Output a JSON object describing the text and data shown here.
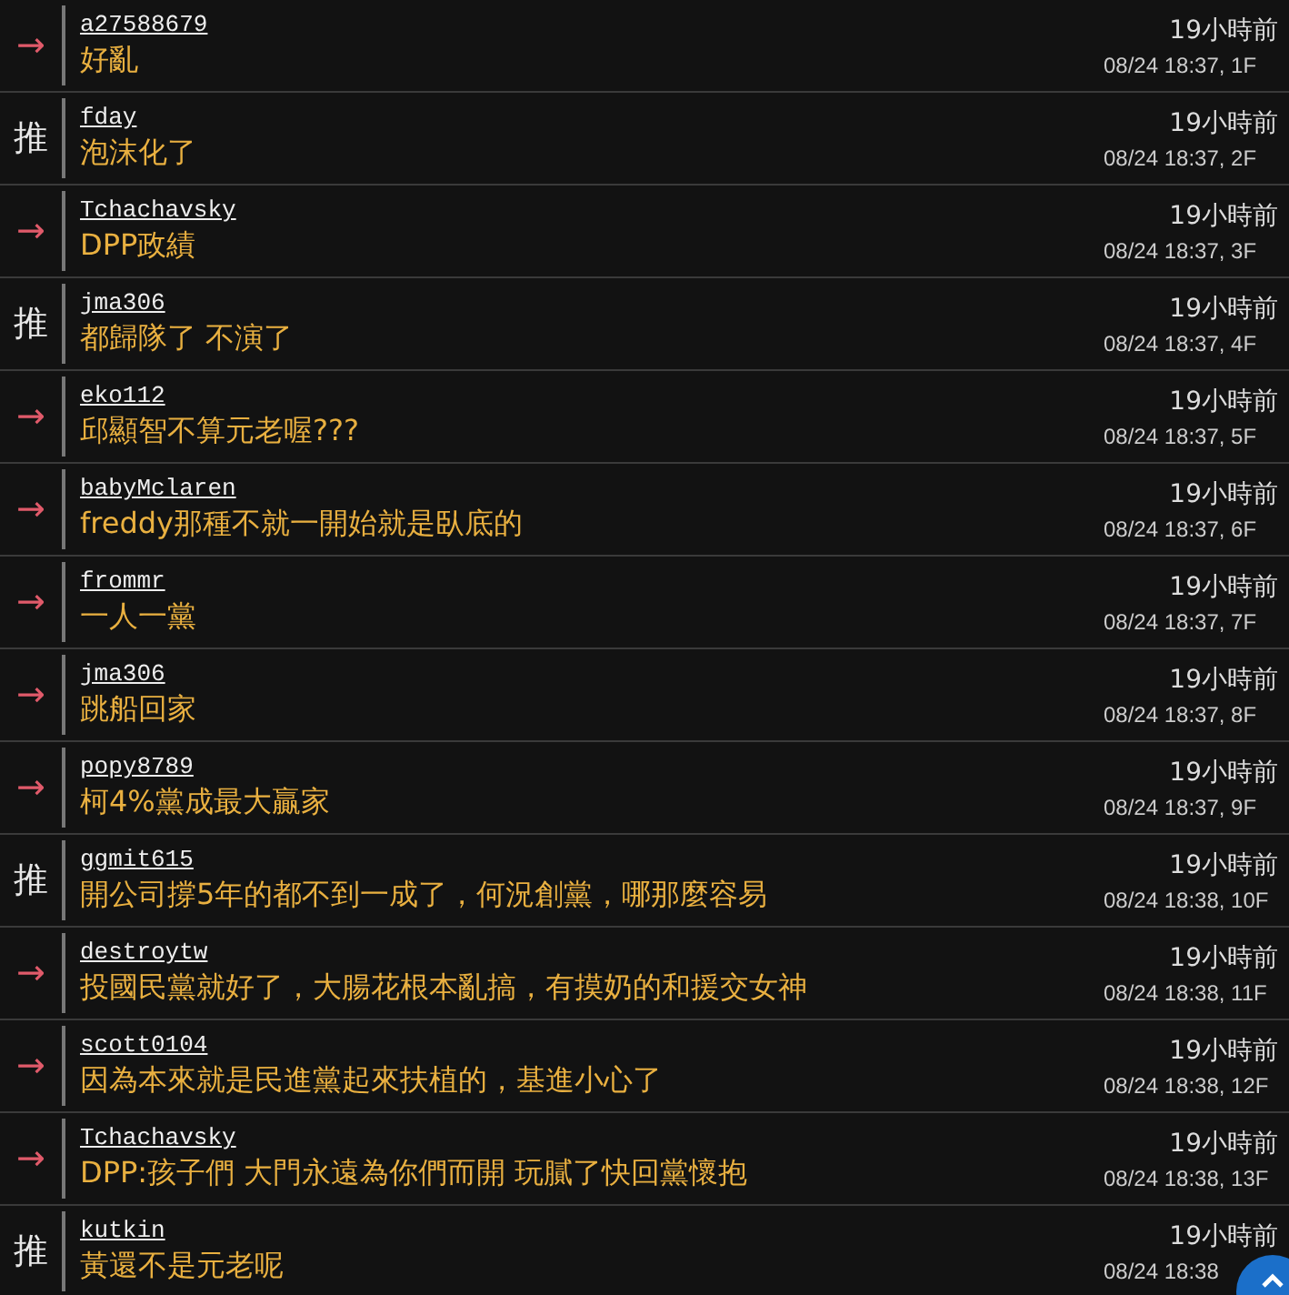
{
  "comments": [
    {
      "tag": "→",
      "kind": "arrow",
      "user": "a27588679",
      "text": "好亂",
      "ago": "19小時前",
      "stamp": "08/24 18:37, 1F"
    },
    {
      "tag": "推",
      "kind": "push",
      "user": "fday",
      "text": "泡沫化了",
      "ago": "19小時前",
      "stamp": "08/24 18:37, 2F"
    },
    {
      "tag": "→",
      "kind": "arrow",
      "user": "Tchachavsky",
      "text": "DPP政績",
      "ago": "19小時前",
      "stamp": "08/24 18:37, 3F"
    },
    {
      "tag": "推",
      "kind": "push",
      "user": "jma306",
      "text": "都歸隊了 不演了",
      "ago": "19小時前",
      "stamp": "08/24 18:37, 4F"
    },
    {
      "tag": "→",
      "kind": "arrow",
      "user": "eko112",
      "text": "邱顯智不算元老喔???",
      "ago": "19小時前",
      "stamp": "08/24 18:37, 5F"
    },
    {
      "tag": "→",
      "kind": "arrow",
      "user": "babyMclaren",
      "text": "freddy那種不就一開始就是臥底的",
      "ago": "19小時前",
      "stamp": "08/24 18:37, 6F"
    },
    {
      "tag": "→",
      "kind": "arrow",
      "user": "frommr",
      "text": "一人一黨",
      "ago": "19小時前",
      "stamp": "08/24 18:37, 7F"
    },
    {
      "tag": "→",
      "kind": "arrow",
      "user": "jma306",
      "text": "跳船回家",
      "ago": "19小時前",
      "stamp": "08/24 18:37, 8F"
    },
    {
      "tag": "→",
      "kind": "arrow",
      "user": "popy8789",
      "text": "柯4%黨成最大贏家",
      "ago": "19小時前",
      "stamp": "08/24 18:37, 9F"
    },
    {
      "tag": "推",
      "kind": "push",
      "user": "ggmit615",
      "text": "開公司撐5年的都不到一成了，何況創黨，哪那麼容易",
      "ago": "19小時前",
      "stamp": "08/24 18:38, 10F"
    },
    {
      "tag": "→",
      "kind": "arrow",
      "user": "destroytw",
      "text": "投國民黨就好了，大腸花根本亂搞，有摸奶的和援交女神",
      "ago": "19小時前",
      "stamp": "08/24 18:38, 11F"
    },
    {
      "tag": "→",
      "kind": "arrow",
      "user": "scott0104",
      "text": "因為本來就是民進黨起來扶植的，基進小心了",
      "ago": "19小時前",
      "stamp": "08/24 18:38, 12F"
    },
    {
      "tag": "→",
      "kind": "arrow",
      "user": "Tchachavsky",
      "text": "DPP:孩子們 大門永遠為你們而開 玩膩了快回黨懷抱",
      "ago": "19小時前",
      "stamp": "08/24 18:38, 13F"
    },
    {
      "tag": "推",
      "kind": "push",
      "user": "kutkin",
      "text": "黃還不是元老呢",
      "ago": "19小時前",
      "stamp": "08/24 18:38"
    }
  ]
}
